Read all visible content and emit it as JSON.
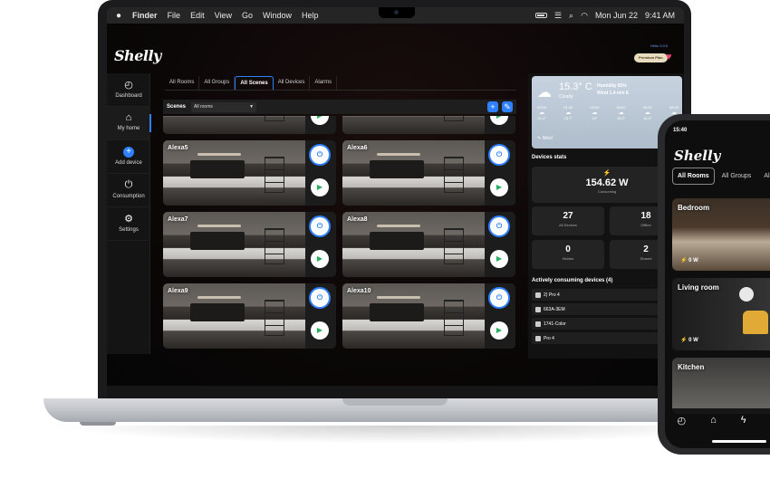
{
  "menubar": {
    "apple": "",
    "items": [
      "Finder",
      "File",
      "Edit",
      "View",
      "Go",
      "Window",
      "Help"
    ],
    "date": "Mon Jun 22",
    "time": "9:41 AM"
  },
  "app": {
    "logo": "Shelly",
    "premium": "Premium Plan",
    "hello": "Hello 3.0.0"
  },
  "sidebar": {
    "items": [
      {
        "label": "Dashboard",
        "icon": "◴"
      },
      {
        "label": "My home",
        "icon": "⌂"
      },
      {
        "label": "Add device",
        "icon": "+"
      },
      {
        "label": "Consumption",
        "icon": "⏻"
      },
      {
        "label": "Settings",
        "icon": "⚙"
      }
    ]
  },
  "tabs": [
    "All Rooms",
    "All Groups",
    "All Scenes",
    "All Devices",
    "Alarms"
  ],
  "scenes": {
    "title": "Scenes",
    "room_select": "All rooms",
    "add": "+",
    "edit": "✎",
    "cards": [
      "",
      "",
      "Alexa5",
      "Alexa6",
      "Alexa7",
      "Alexa8",
      "Alexa9",
      "Alexa10"
    ]
  },
  "weather": {
    "temp": "15.3° C",
    "condition": "Cloudy",
    "humidity": "Humidity 65%",
    "wind": "Wind 1.4 m/s E",
    "forecast": [
      {
        "time": "00:00",
        "temp": "15.4°"
      },
      {
        "time": "01:00",
        "temp": "15.7°"
      },
      {
        "time": "02:00",
        "temp": "16°"
      },
      {
        "time": "03:00",
        "temp": "16.2°"
      },
      {
        "time": "04:00",
        "temp": "16.3°"
      },
      {
        "time": "05:00",
        "temp": "16.5°"
      }
    ],
    "user": "Nikol"
  },
  "stats": {
    "title": "Devices stats",
    "power": "154.62 W",
    "power_caption": "Consuming",
    "all_devices": "27",
    "all_devices_caption": "All Devices",
    "offline": "18",
    "offline_caption": "Offline",
    "hidden": "0",
    "hidden_caption": "Hidden",
    "shared": "2",
    "shared_caption": "Shared"
  },
  "consuming": {
    "title": "Actively consuming devices (4)",
    "devices": [
      "2) Pro 4",
      "663A-3EM",
      "1741-Color",
      "Pro 4"
    ]
  },
  "phone": {
    "time": "15:40",
    "logo": "Shelly",
    "tabs": [
      "All Rooms",
      "All Groups",
      "All"
    ],
    "rooms": [
      {
        "name": "Bedroom",
        "power": "⚡ 0 W"
      },
      {
        "name": "Living room",
        "power": "⚡ 0 W"
      },
      {
        "name": "Kitchen",
        "power": ""
      }
    ]
  },
  "colors": {
    "accent": "#2f80ff",
    "play": "#27ae60",
    "power_bolt": "#e74c3c"
  }
}
